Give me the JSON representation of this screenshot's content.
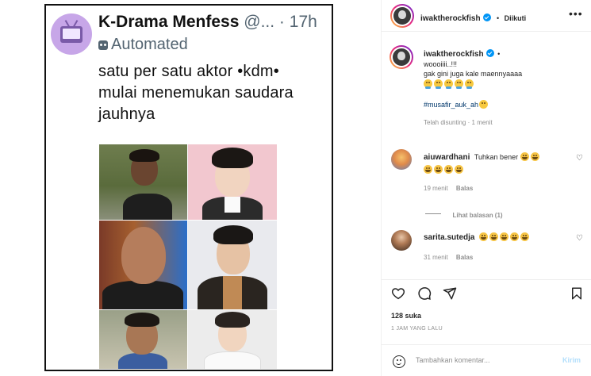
{
  "tweet": {
    "display_name": "K-Drama Menfess",
    "handle": "@...",
    "separator": "·",
    "time": "17h",
    "automated_label": "Automated",
    "text_lines": [
      "satu per satu aktor •kdm•",
      "mulai menemukan saudara",
      "jauhnya"
    ]
  },
  "panel": {
    "header": {
      "username": "iwaktherockfish",
      "follow_separator": "•",
      "follow_status": "Diikuti",
      "more_icon": "more-horizontal-icon"
    },
    "caption": {
      "username": "iwaktherockfish",
      "dot": "•",
      "line1": "woooiiii..!!!",
      "line2": "gak gini juga kale maennyaaaa",
      "emoji_count": 5,
      "hashtag": "#musafir_auk_ah",
      "edited_label": "Telah disunting",
      "edited_sep": "·",
      "edited_time": "1 menit"
    },
    "comments": [
      {
        "username": "aiuwardhani",
        "text": "Tuhkan bener",
        "inline_emoji_count": 2,
        "second_line_emoji_count": 4,
        "time": "19 menit",
        "reply_label": "Balas",
        "view_replies_label": "Lihat balasan (1)"
      },
      {
        "username": "sarita.sutedja",
        "inline_emoji_count": 5,
        "time": "31 menit",
        "reply_label": "Balas"
      }
    ],
    "likes": "128 suka",
    "date": "1 JAM YANG LALU",
    "comment_input": {
      "placeholder": "Tambahkan komentar...",
      "post_label": "Kirim"
    },
    "colors": {
      "accent": "#0095f6",
      "hashtag": "#00376b",
      "muted": "#8e8e8e",
      "post_disabled": "#b2dffc"
    }
  }
}
